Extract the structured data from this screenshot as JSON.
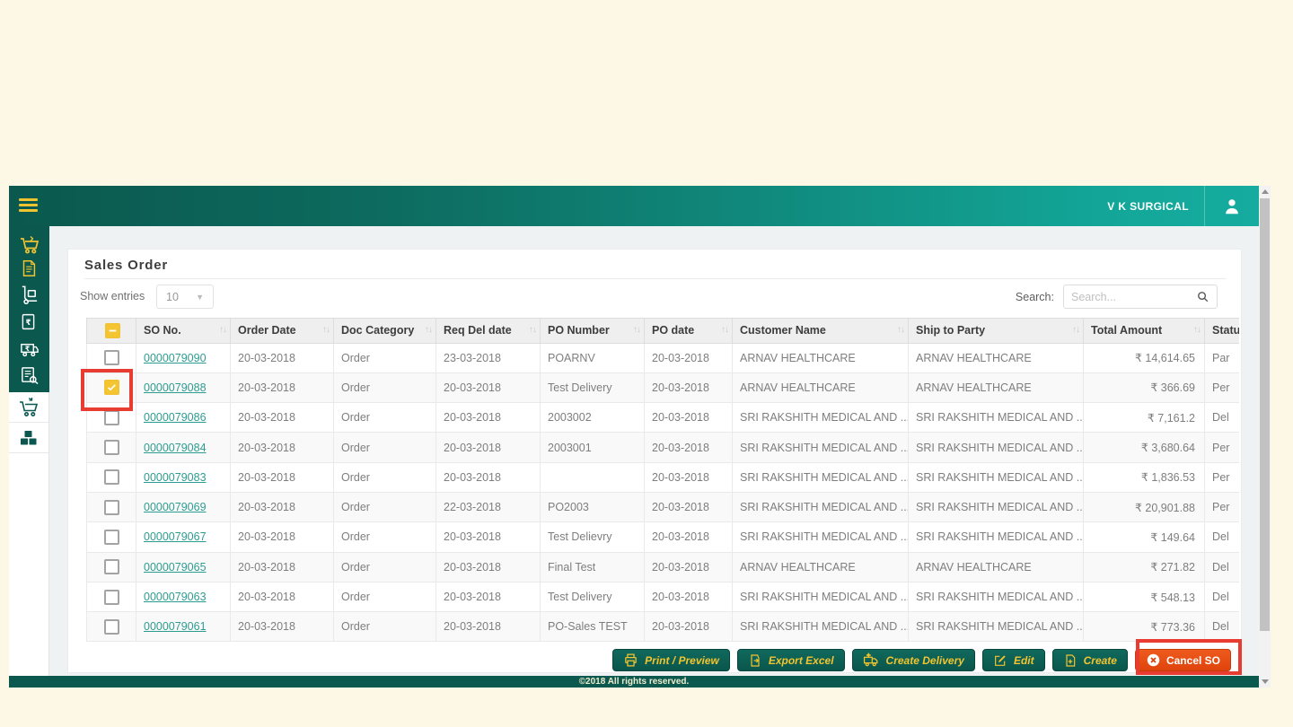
{
  "header": {
    "brand": "V K SURGICAL"
  },
  "sidebar": {
    "items": [
      {
        "name": "sales-cart"
      },
      {
        "name": "invoice"
      },
      {
        "name": "delivery-dolly"
      },
      {
        "name": "rupee-document"
      },
      {
        "name": "rupee-truck"
      },
      {
        "name": "order-search"
      },
      {
        "name": "cart-return"
      },
      {
        "name": "inventory-boxes"
      }
    ]
  },
  "content": {
    "title": "Sales Order",
    "show_entries_label": "Show entries",
    "entries_value": "10",
    "search_label": "Search:",
    "search_placeholder": "Search...",
    "table": {
      "columns": [
        {
          "key": "checkbox",
          "label": "",
          "sortable": false
        },
        {
          "key": "so_no",
          "label": "SO No.",
          "sortable": true
        },
        {
          "key": "order_date",
          "label": "Order Date",
          "sortable": true
        },
        {
          "key": "doc_category",
          "label": "Doc Category",
          "sortable": true
        },
        {
          "key": "req_del_date",
          "label": "Req Del date",
          "sortable": true
        },
        {
          "key": "po_number",
          "label": "PO Number",
          "sortable": true
        },
        {
          "key": "po_date",
          "label": "PO date",
          "sortable": true
        },
        {
          "key": "customer_name",
          "label": "Customer Name",
          "sortable": true
        },
        {
          "key": "ship_to_party",
          "label": "Ship to Party",
          "sortable": true
        },
        {
          "key": "total_amount",
          "label": "Total Amount",
          "sortable": true
        },
        {
          "key": "status",
          "label": "Status",
          "sortable": true
        }
      ],
      "rows": [
        {
          "checked": false,
          "so_no": "0000079090",
          "order_date": "20-03-2018",
          "doc_category": "Order",
          "req_del_date": "23-03-2018",
          "po_number": "POARNV",
          "po_date": "20-03-2018",
          "customer_name": "ARNAV HEALTHCARE",
          "ship_to_party": "ARNAV HEALTHCARE",
          "total_amount": "₹ 14,614.65",
          "status": "Par"
        },
        {
          "checked": true,
          "so_no": "0000079088",
          "order_date": "20-03-2018",
          "doc_category": "Order",
          "req_del_date": "20-03-2018",
          "po_number": "Test Delivery",
          "po_date": "20-03-2018",
          "customer_name": "ARNAV HEALTHCARE",
          "ship_to_party": "ARNAV HEALTHCARE",
          "total_amount": "₹ 366.69",
          "status": "Per"
        },
        {
          "checked": false,
          "so_no": "0000079086",
          "order_date": "20-03-2018",
          "doc_category": "Order",
          "req_del_date": "20-03-2018",
          "po_number": "2003002",
          "po_date": "20-03-2018",
          "customer_name": "SRI RAKSHITH MEDICAL AND ...",
          "ship_to_party": "SRI RAKSHITH MEDICAL AND ...",
          "total_amount": "₹ 7,161.2",
          "status": "Del"
        },
        {
          "checked": false,
          "so_no": "0000079084",
          "order_date": "20-03-2018",
          "doc_category": "Order",
          "req_del_date": "20-03-2018",
          "po_number": "2003001",
          "po_date": "20-03-2018",
          "customer_name": "SRI RAKSHITH MEDICAL AND ...",
          "ship_to_party": "SRI RAKSHITH MEDICAL AND ...",
          "total_amount": "₹ 3,680.64",
          "status": "Per"
        },
        {
          "checked": false,
          "so_no": "0000079083",
          "order_date": "20-03-2018",
          "doc_category": "Order",
          "req_del_date": "20-03-2018",
          "po_number": "",
          "po_date": "20-03-2018",
          "customer_name": "SRI RAKSHITH MEDICAL AND ...",
          "ship_to_party": "SRI RAKSHITH MEDICAL AND ...",
          "total_amount": "₹ 1,836.53",
          "status": "Per"
        },
        {
          "checked": false,
          "so_no": "0000079069",
          "order_date": "20-03-2018",
          "doc_category": "Order",
          "req_del_date": "22-03-2018",
          "po_number": "PO2003",
          "po_date": "20-03-2018",
          "customer_name": "SRI RAKSHITH MEDICAL AND ...",
          "ship_to_party": "SRI RAKSHITH MEDICAL AND ...",
          "total_amount": "₹ 20,901.88",
          "status": "Per"
        },
        {
          "checked": false,
          "so_no": "0000079067",
          "order_date": "20-03-2018",
          "doc_category": "Order",
          "req_del_date": "20-03-2018",
          "po_number": "Test Delievry",
          "po_date": "20-03-2018",
          "customer_name": "SRI RAKSHITH MEDICAL AND ...",
          "ship_to_party": "SRI RAKSHITH MEDICAL AND ...",
          "total_amount": "₹ 149.64",
          "status": "Del"
        },
        {
          "checked": false,
          "so_no": "0000079065",
          "order_date": "20-03-2018",
          "doc_category": "Order",
          "req_del_date": "20-03-2018",
          "po_number": "Final Test",
          "po_date": "20-03-2018",
          "customer_name": "ARNAV HEALTHCARE",
          "ship_to_party": "ARNAV HEALTHCARE",
          "total_amount": "₹ 271.82",
          "status": "Del"
        },
        {
          "checked": false,
          "so_no": "0000079063",
          "order_date": "20-03-2018",
          "doc_category": "Order",
          "req_del_date": "20-03-2018",
          "po_number": "Test Delivery",
          "po_date": "20-03-2018",
          "customer_name": "SRI RAKSHITH MEDICAL AND ...",
          "ship_to_party": "SRI RAKSHITH MEDICAL AND ...",
          "total_amount": "₹ 548.13",
          "status": "Del"
        },
        {
          "checked": false,
          "so_no": "0000079061",
          "order_date": "20-03-2018",
          "doc_category": "Order",
          "req_del_date": "20-03-2018",
          "po_number": "PO-Sales TEST",
          "po_date": "20-03-2018",
          "customer_name": "SRI RAKSHITH MEDICAL AND ...",
          "ship_to_party": "SRI RAKSHITH MEDICAL AND ...",
          "total_amount": "₹ 773.36",
          "status": "Del"
        }
      ]
    },
    "buttons": [
      {
        "id": "print",
        "label": "Print / Preview"
      },
      {
        "id": "export",
        "label": "Export Excel"
      },
      {
        "id": "delivery",
        "label": "Create Delivery"
      },
      {
        "id": "edit",
        "label": "Edit"
      },
      {
        "id": "create",
        "label": "Create"
      },
      {
        "id": "cancel",
        "label": "Cancel SO"
      }
    ]
  },
  "footer": {
    "text": "©2018 All rights reserved."
  },
  "colors": {
    "teal_dark": "#0b584e",
    "teal_light": "#13a89a",
    "accent_yellow": "#f2c430",
    "cancel_orange": "#e54b10",
    "annotation_red": "#e83b32",
    "link_teal": "#2d9c90",
    "page_cream": "#fdf8e6"
  }
}
